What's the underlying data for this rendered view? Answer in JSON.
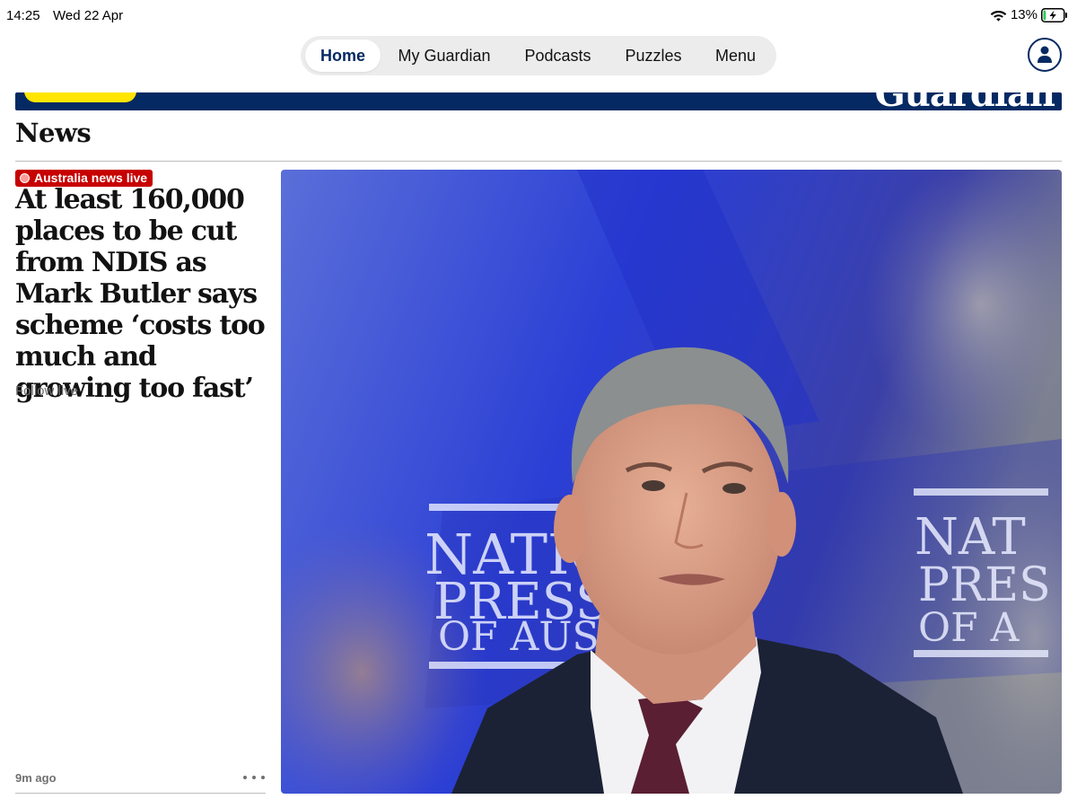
{
  "status_bar": {
    "time": "14:25",
    "date": "Wed 22 Apr",
    "battery_percent": "13%",
    "battery_level": 0.13,
    "icons": [
      "wifi-icon",
      "battery-charging-icon"
    ]
  },
  "nav": {
    "tabs": [
      {
        "label": "Home",
        "active": true
      },
      {
        "label": "My Guardian",
        "active": false
      },
      {
        "label": "Podcasts",
        "active": false
      },
      {
        "label": "Puzzles",
        "active": false
      },
      {
        "label": "Menu",
        "active": false
      }
    ],
    "profile_icon": "person-icon"
  },
  "masthead": {
    "logo_text": "Guardian",
    "brand_color": "#052962",
    "support_color": "#ffe500"
  },
  "section": {
    "title": "News"
  },
  "article": {
    "kicker": "Australia news live",
    "kicker_color": "#c70000",
    "headline": "At least 160,000 places to be cut from NDIS as Mark Butler says scheme ‘costs too much and growing too fast’",
    "follow_label": "Follow live",
    "timestamp": "9m ago",
    "more_icon": "more-dots-icon",
    "image": {
      "backdrop_text_left": [
        "NATIO",
        "PRESS C",
        "OF AUSTR"
      ],
      "backdrop_text_right": [
        "NAT",
        "PRES",
        "OF A"
      ]
    }
  }
}
